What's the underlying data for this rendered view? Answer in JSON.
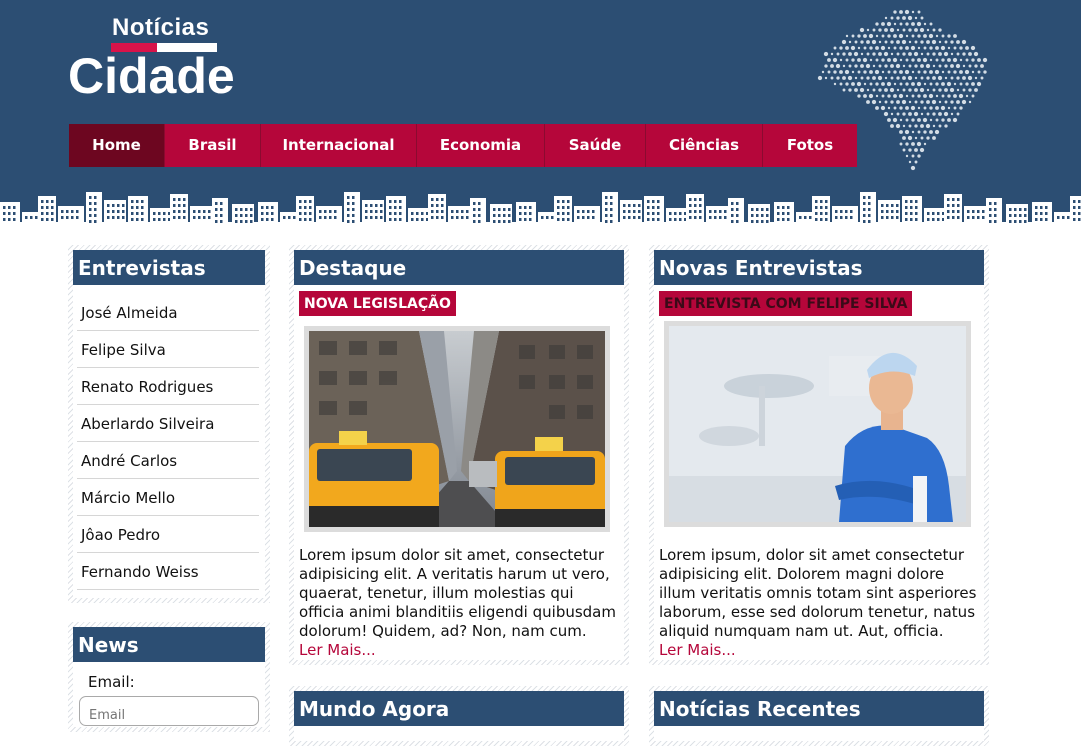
{
  "logo": {
    "line1": "Notícias",
    "line2": "Cidade"
  },
  "nav": [
    {
      "label": "Home",
      "active": true
    },
    {
      "label": "Brasil"
    },
    {
      "label": "Internacional"
    },
    {
      "label": "Economia"
    },
    {
      "label": "Saúde"
    },
    {
      "label": "Ciências"
    },
    {
      "label": "Fotos"
    }
  ],
  "entrevistas": {
    "title": "Entrevistas",
    "items": [
      "José Almeida",
      "Felipe Silva",
      "Renato Rodrigues",
      "Aberlardo Silveira",
      "André Carlos",
      "Márcio Mello",
      "Jôao Pedro",
      "Fernando Weiss"
    ]
  },
  "news": {
    "title": "News",
    "email_label": "Email:",
    "email_placeholder": "Email"
  },
  "destaque": {
    "title": "Destaque",
    "tag": "NOVA LEGISLAÇÃO",
    "image_icon": "city-taxi-photo",
    "text": "Lorem ipsum dolor sit amet, consectetur adipisicing elit. A veritatis harum ut vero, quaerat, tenetur, illum molestias qui officia animi blanditiis eligendi quibusdam dolorum! Quidem, ad? Non, nam cum.",
    "more": "Ler Mais..."
  },
  "novas": {
    "title": "Novas Entrevistas",
    "tag": "ENTREVISTA COM FELIPE SILVA",
    "image_icon": "doctor-photo",
    "text": "Lorem ipsum, dolor sit amet consectetur adipisicing elit. Dolorem magni dolore illum veritatis omnis totam sint asperiores laborum, esse sed dolorum tenetur, natus aliquid numquam nam ut. Aut, officia.",
    "more": "Ler Mais..."
  },
  "mundo": {
    "title": "Mundo Agora"
  },
  "recentes": {
    "title": "Notícias Recentes"
  },
  "colors": {
    "header": "#2c4e73",
    "accent": "#b5063a",
    "nav_active": "#6d0620"
  }
}
